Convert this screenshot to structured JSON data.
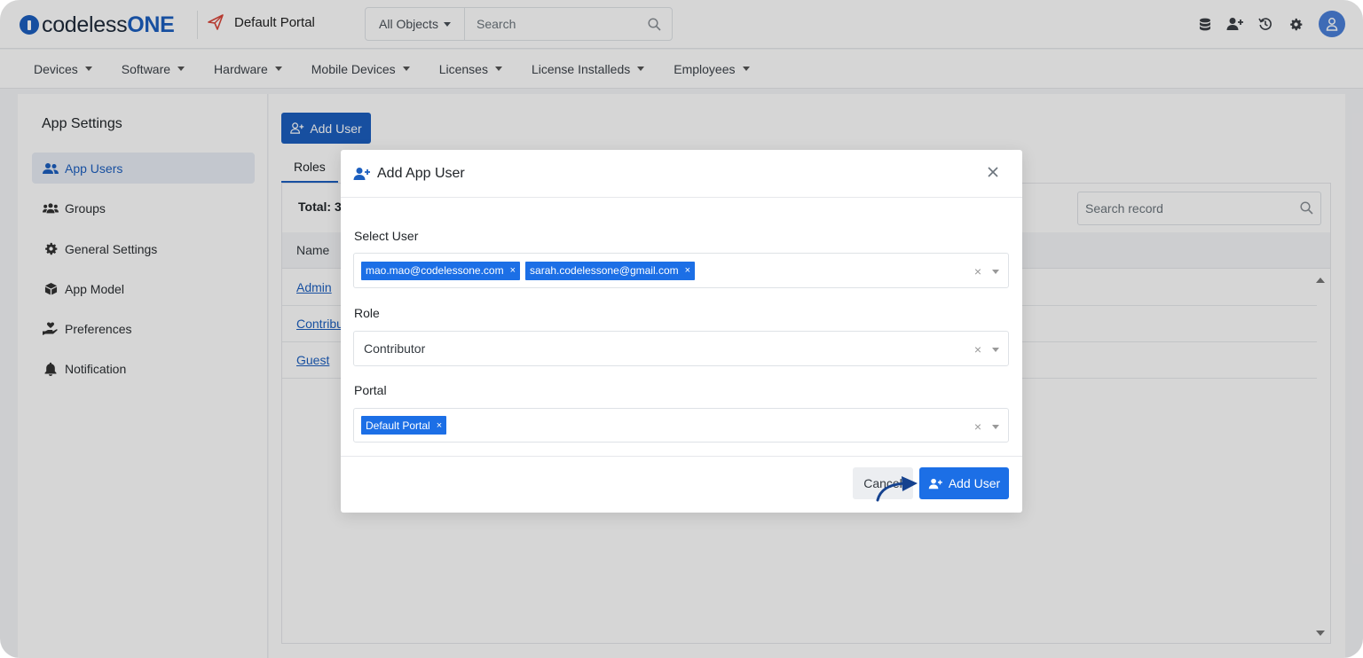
{
  "header": {
    "logo_text_bold": "codeless",
    "logo_text_rest": "ONE",
    "portal_name": "Default Portal",
    "object_select": "All Objects",
    "search_placeholder": "Search"
  },
  "nav": {
    "items": [
      {
        "label": "Devices"
      },
      {
        "label": "Software"
      },
      {
        "label": "Hardware"
      },
      {
        "label": "Mobile Devices"
      },
      {
        "label": "Licenses"
      },
      {
        "label": "License Installeds"
      },
      {
        "label": "Employees"
      }
    ]
  },
  "sidebar": {
    "title": "App Settings",
    "items": [
      {
        "label": "App Users",
        "icon": "users-icon",
        "active": true
      },
      {
        "label": "Groups",
        "icon": "groups-icon"
      },
      {
        "label": "General Settings",
        "icon": "gear-icon"
      },
      {
        "label": "App Model",
        "icon": "cube-icon"
      },
      {
        "label": "Preferences",
        "icon": "hand-heart-icon"
      },
      {
        "label": "Notification",
        "icon": "bell-icon"
      }
    ]
  },
  "main": {
    "add_user_label": "Add User",
    "tab_roles": "Roles",
    "total_label": "Total: 3",
    "search_record_placeholder": "Search record",
    "table": {
      "column_name": "Name",
      "rows": [
        "Admin",
        "Contribu",
        "Guest"
      ]
    }
  },
  "modal": {
    "title": "Add App User",
    "select_user_label": "Select User",
    "selected_users": [
      "mao.mao@codelessone.com",
      "sarah.codelessone@gmail.com"
    ],
    "role_label": "Role",
    "role_value": "Contributor",
    "portal_label": "Portal",
    "portal_value": "Default Portal",
    "clear_symbol": "×",
    "cancel_label": "Cancel",
    "add_label": "Add User"
  },
  "colors": {
    "primary": "#1c5fbf",
    "chip": "#1c6fe6",
    "overlay": "rgba(0,0,0,0.16)"
  }
}
